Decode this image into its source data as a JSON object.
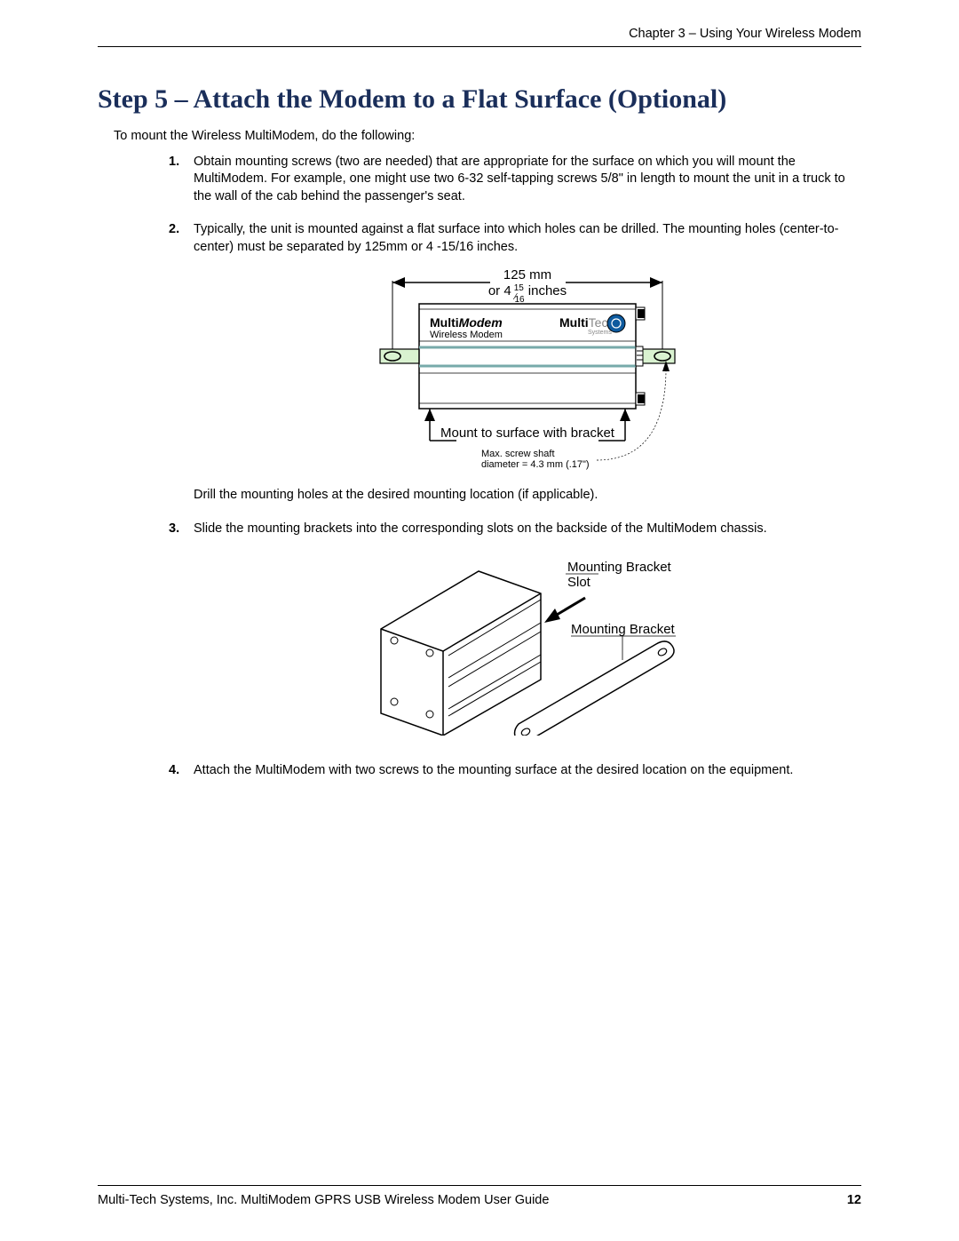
{
  "header": {
    "chapter_line": "Chapter 3 – Using Your Wireless Modem"
  },
  "section": {
    "title": "Step 5 – Attach the Modem to a Flat Surface (Optional)",
    "intro": "To mount the Wireless MultiModem, do the following:"
  },
  "steps": [
    {
      "num": "1.",
      "text": "Obtain mounting screws (two are needed) that are appropriate for the surface on which you will mount the MultiModem. For example, one might use two 6-32 self-tapping screws 5/8\" in length to mount the unit in a truck to the wall of the cab behind the passenger's seat."
    },
    {
      "num": "2.",
      "text": "Typically, the unit is mounted against a flat surface into which holes can be drilled.  The mounting holes (center-to-center) must be separated by 125mm or 4 -15/16 inches.",
      "ext": "Drill the mounting holes at the desired mounting location (if applicable)."
    },
    {
      "num": "3.",
      "text": "Slide the mounting brackets into the corresponding slots on the backside of the MultiModem chassis."
    },
    {
      "num": "4.",
      "text": "Attach the MultiModem with two screws to the mounting surface at the desired location on the equipment."
    }
  ],
  "diagram1": {
    "dim_mm": "125 mm",
    "dim_in_prefix": "or 4",
    "dim_in_frac_num": "15",
    "dim_in_frac_den": "16",
    "dim_in_suffix": " inches",
    "device_label1": "Multi",
    "device_label1b": "Modem",
    "device_label2": "Wireless Modem",
    "brand1": "Multi",
    "brand2": "Tech",
    "brand3": "Systems",
    "mount_note": "Mount to surface with bracket",
    "screw_note1": "Max. screw shaft",
    "screw_note2": "diameter = 4.3 mm (.17\")"
  },
  "diagram2": {
    "label1": "Mounting Bracket",
    "label1b": "Slot",
    "label2": "Mounting Bracket"
  },
  "footer": {
    "text": "Multi-Tech Systems, Inc. MultiModem GPRS USB Wireless Modem User Guide",
    "page": "12"
  }
}
